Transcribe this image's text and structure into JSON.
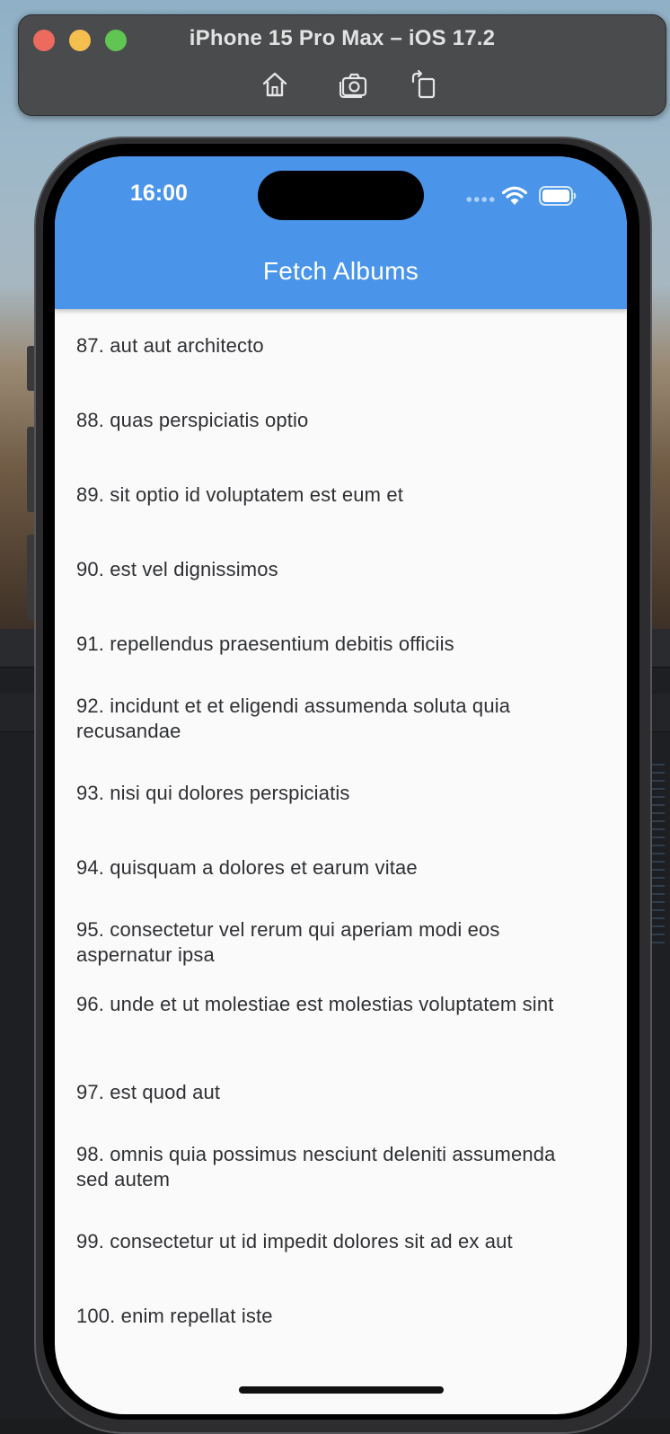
{
  "simulator": {
    "title": "iPhone 15 Pro Max – iOS 17.2",
    "tools": [
      "home-icon",
      "screenshot-icon",
      "rotate-icon"
    ]
  },
  "status_bar": {
    "time": "16:00"
  },
  "app_bar": {
    "title": "Fetch Albums",
    "color": "#4a95ea"
  },
  "albums": [
    "87. aut aut architecto",
    "88. quas perspiciatis optio",
    "89. sit optio id voluptatem est eum et",
    "90. est vel dignissimos",
    "91. repellendus praesentium debitis officiis",
    "92. incidunt et et eligendi assumenda soluta quia recusandae",
    "93. nisi qui dolores perspiciatis",
    "94. quisquam a dolores et earum vitae",
    "95. consectetur vel rerum qui aperiam modi eos aspernatur ipsa",
    "96. unde et ut molestiae est molestias voluptatem sint",
    "97. est quod aut",
    "98. omnis quia possimus nesciunt deleniti assumenda sed autem",
    "99. consectetur ut id impedit dolores sit ad ex aut",
    "100. enim repellat iste"
  ]
}
